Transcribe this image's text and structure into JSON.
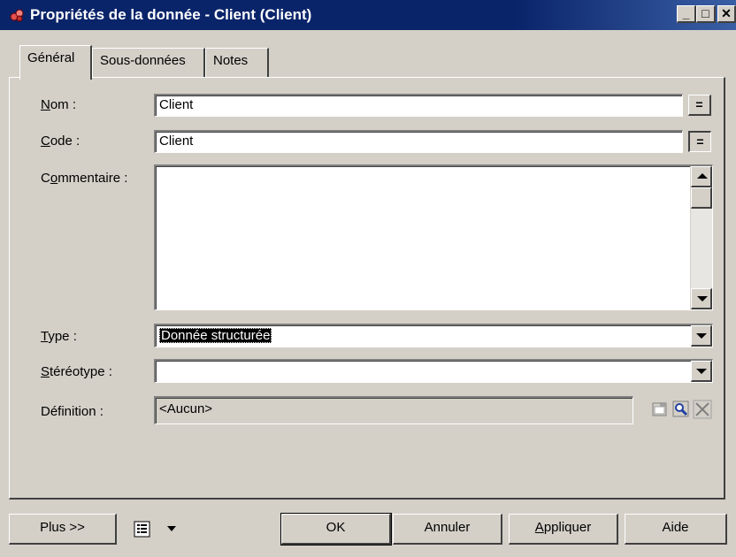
{
  "window": {
    "title": "Propriétés de la donnée - Client (Client)",
    "buttons": {
      "minimize": "_",
      "maximize": "□",
      "close": "✕"
    }
  },
  "tabs": [
    {
      "label": "Général",
      "active": true
    },
    {
      "label": "Sous-données",
      "active": false
    },
    {
      "label": "Notes",
      "active": false
    }
  ],
  "form": {
    "nom": {
      "mnemonic": "N",
      "rest": "om :",
      "value": "Client",
      "sync_label": "="
    },
    "code": {
      "mnemonic": "C",
      "rest": "ode :",
      "value": "Client",
      "sync_label": "="
    },
    "commentaire": {
      "pre": "C",
      "mnemonic": "o",
      "rest": "mmentaire :",
      "value": ""
    },
    "type": {
      "mnemonic": "T",
      "rest": "ype :",
      "value": "Donnée structurée"
    },
    "stereotype": {
      "mnemonic": "S",
      "rest": "téréotype :",
      "value": ""
    },
    "definition": {
      "label": "Définition :",
      "value": "<Aucun>"
    }
  },
  "footer": {
    "plus": "Plus >>",
    "ok": "OK",
    "annuler": "Annuler",
    "appliquer_mnemonic": "A",
    "appliquer_rest": "ppliquer",
    "aide": "Aide"
  },
  "icons": {
    "app": "data-properties-icon",
    "properties": "properties-icon",
    "find": "find-icon",
    "clear": "clear-icon",
    "list_menu": "list-menu-icon"
  },
  "colors": {
    "titlebar": "#0a246a",
    "face": "#d4d0c8",
    "selection": "#000000"
  }
}
